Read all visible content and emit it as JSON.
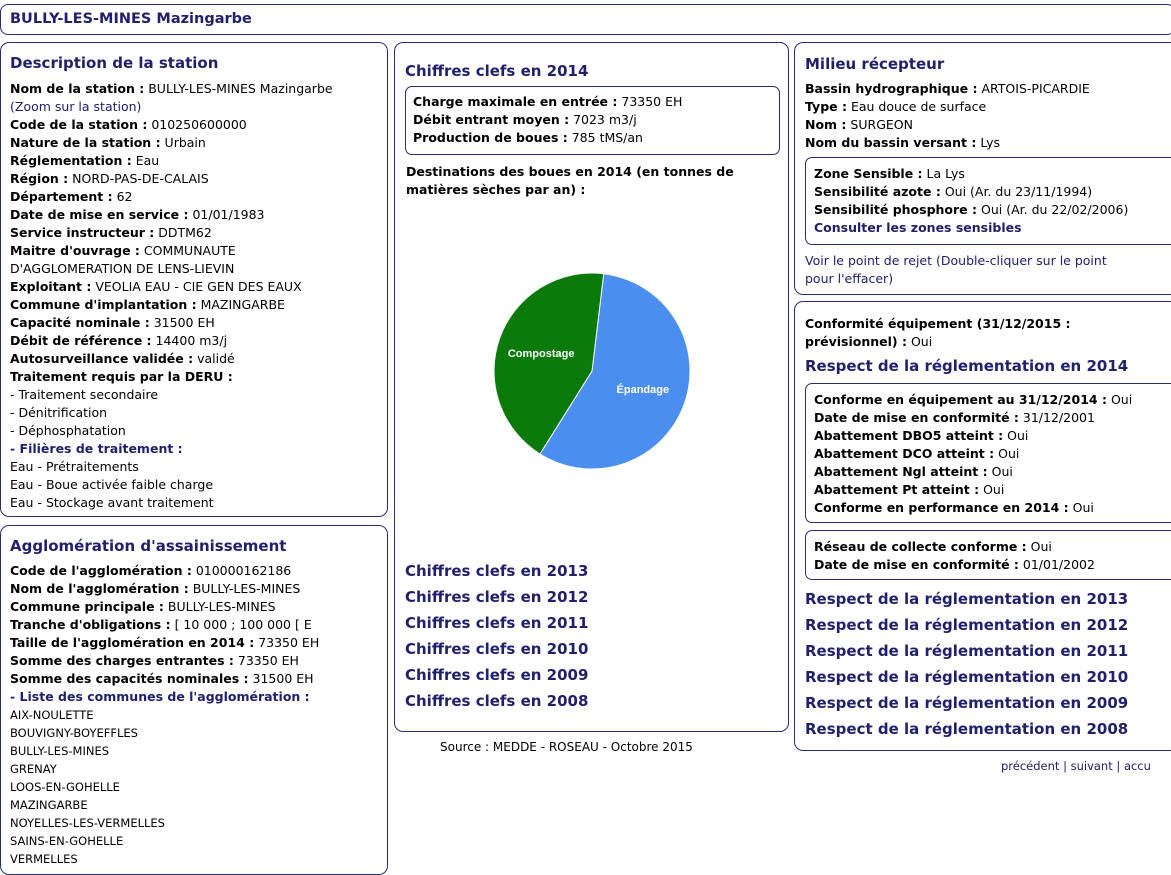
{
  "header": {
    "title": "BULLY-LES-MINES Mazingarbe"
  },
  "station": {
    "title": "Description de la station",
    "name_label": "Nom de la station :",
    "name_value": "BULLY-LES-MINES Mazingarbe",
    "zoom_link": "(Zoom sur la station)",
    "code_label": "Code de la station :",
    "code_value": "010250600000",
    "nature_label": "Nature de la station :",
    "nature_value": "Urbain",
    "regl_label": "Réglementation :",
    "regl_value": "Eau",
    "region_label": "Région :",
    "region_value": "NORD-PAS-DE-CALAIS",
    "dept_label": "Département :",
    "dept_value": "62",
    "date_label": "Date de mise en service :",
    "date_value": "01/01/1983",
    "service_label": "Service instructeur :",
    "service_value": "DDTM62",
    "maitre_label": "Maitre d'ouvrage :",
    "maitre_value": "COMMUNAUTE",
    "maitre_value2": "D'AGGLOMERATION DE LENS-LIEVIN",
    "exploitant_label": "Exploitant :",
    "exploitant_value": "VEOLIA EAU - CIE GEN DES EAUX",
    "commune_label": "Commune d'implantation :",
    "commune_value": "MAZINGARBE",
    "capacite_label": "Capacité nominale :",
    "capacite_value": "31500 EH",
    "debit_label": "Débit de référence :",
    "debit_value": "14400 m3/j",
    "auto_label": "Autosurveillance validée :",
    "auto_value": "validé",
    "deru_label": "Traitement requis par la DERU :",
    "deru_items": [
      "- Traitement secondaire",
      "- Dénitrification",
      "- Déphosphatation"
    ],
    "filieres_label": "- Filières de traitement :",
    "filieres_items": [
      "Eau - Prétraitements",
      "Eau - Boue activée faible charge",
      "Eau - Stockage avant traitement"
    ]
  },
  "agglo": {
    "title": "Agglomération d'assainissement",
    "code_label": "Code de l'agglomération :",
    "code_value": "010000162186",
    "nom_label": "Nom de l'agglomération :",
    "nom_value": "BULLY-LES-MINES",
    "commune_label": "Commune principale :",
    "commune_value": "BULLY-LES-MINES",
    "tranche_label": "Tranche d'obligations :",
    "tranche_value": "[ 10 000 ; 100 000 [ E",
    "taille_label": "Taille de l'agglomération en 2014 :",
    "taille_value": "73350 EH",
    "charges_label": "Somme des charges entrantes :",
    "charges_value": "73350 EH",
    "capacites_label": "Somme des capacités nominales :",
    "capacites_value": "31500 EH",
    "liste_label": "- Liste des communes de l'agglomération :",
    "communes": [
      "AIX-NOULETTE",
      "BOUVIGNY-BOYEFFLES",
      "BULLY-LES-MINES",
      "GRENAY",
      "LOOS-EN-GOHELLE",
      "MAZINGARBE",
      "NOYELLES-LES-VERMELLES",
      "SAINS-EN-GOHELLE",
      "VERMELLES"
    ]
  },
  "chiffres": {
    "title": "Chiffres clefs en 2014",
    "charge_label": "Charge maximale en entrée :",
    "charge_value": "73350 EH",
    "debit_label": "Débit entrant moyen :",
    "debit_value": "7023 m3/j",
    "boues_label": "Production de boues :",
    "boues_value": "785 tMS/an",
    "dest_title_1": "Destinations des boues en 2014 (en tonnes de",
    "dest_title_2": "matières sèches par an) :",
    "years": [
      "Chiffres clefs en 2013",
      "Chiffres clefs en 2012",
      "Chiffres clefs en 2011",
      "Chiffres clefs en 2010",
      "Chiffres clefs en 2009",
      "Chiffres clefs en 2008"
    ],
    "source": "Source : MEDDE - ROSEAU - Octobre 2015"
  },
  "chart_data": {
    "type": "pie",
    "categories": [
      "Épandage",
      "Compostage"
    ],
    "values": [
      57,
      43
    ],
    "colors": [
      "#4a8ef0",
      "#0a7a0a"
    ]
  },
  "milieu": {
    "title": "Milieu récepteur",
    "bassin_label": "Bassin hydrographique :",
    "bassin_value": "ARTOIS-PICARDIE",
    "type_label": "Type :",
    "type_value": "Eau douce de surface",
    "nom_label": "Nom :",
    "nom_value": "SURGEON",
    "versant_label": "Nom du bassin versant :",
    "versant_value": "Lys",
    "zone_label": "Zone Sensible :",
    "zone_value": "La Lys",
    "azote_label": "Sensibilité azote :",
    "azote_value": "Oui (Ar. du 23/11/1994)",
    "phos_label": "Sensibilité phosphore :",
    "phos_value": "Oui (Ar. du 22/02/2006)",
    "zones_link": "Consulter les zones sensibles",
    "rejet_link_1": "Voir le point de rejet (Double-cliquer sur le point",
    "rejet_link_2": "pour l'effacer)"
  },
  "conformite": {
    "equip_label_1": "Conformité équipement (31/12/2015 :",
    "equip_label_2": "prévisionnel) :",
    "equip_value": "Oui",
    "title": "Respect de la réglementation en 2014",
    "conf_equip_label": "Conforme en équipement au 31/12/2014 :",
    "conf_equip_value": "Oui",
    "date_label": "Date de mise en conformité :",
    "date_value": "31/12/2001",
    "dbo5_label": "Abattement DBO5 atteint :",
    "dbo5_value": "Oui",
    "dco_label": "Abattement DCO atteint :",
    "dco_value": "Oui",
    "ngl_label": "Abattement Ngl atteint :",
    "ngl_value": "Oui",
    "pt_label": "Abattement Pt atteint :",
    "pt_value": "Oui",
    "perf_label": "Conforme en performance en 2014 :",
    "perf_value": "Oui",
    "reseau_label": "Réseau de collecte conforme :",
    "reseau_value": "Oui",
    "reseau_date_label": "Date de mise en conformité :",
    "reseau_date_value": "01/01/2002",
    "years": [
      "Respect de la réglementation en 2013",
      "Respect de la réglementation en 2012",
      "Respect de la réglementation en 2011",
      "Respect de la réglementation en 2010",
      "Respect de la réglementation en 2009",
      "Respect de la réglementation en 2008"
    ]
  },
  "nav": {
    "prev": "précédent",
    "sep1": " | ",
    "next": "suivant",
    "sep2": " | ",
    "home": "accu"
  }
}
